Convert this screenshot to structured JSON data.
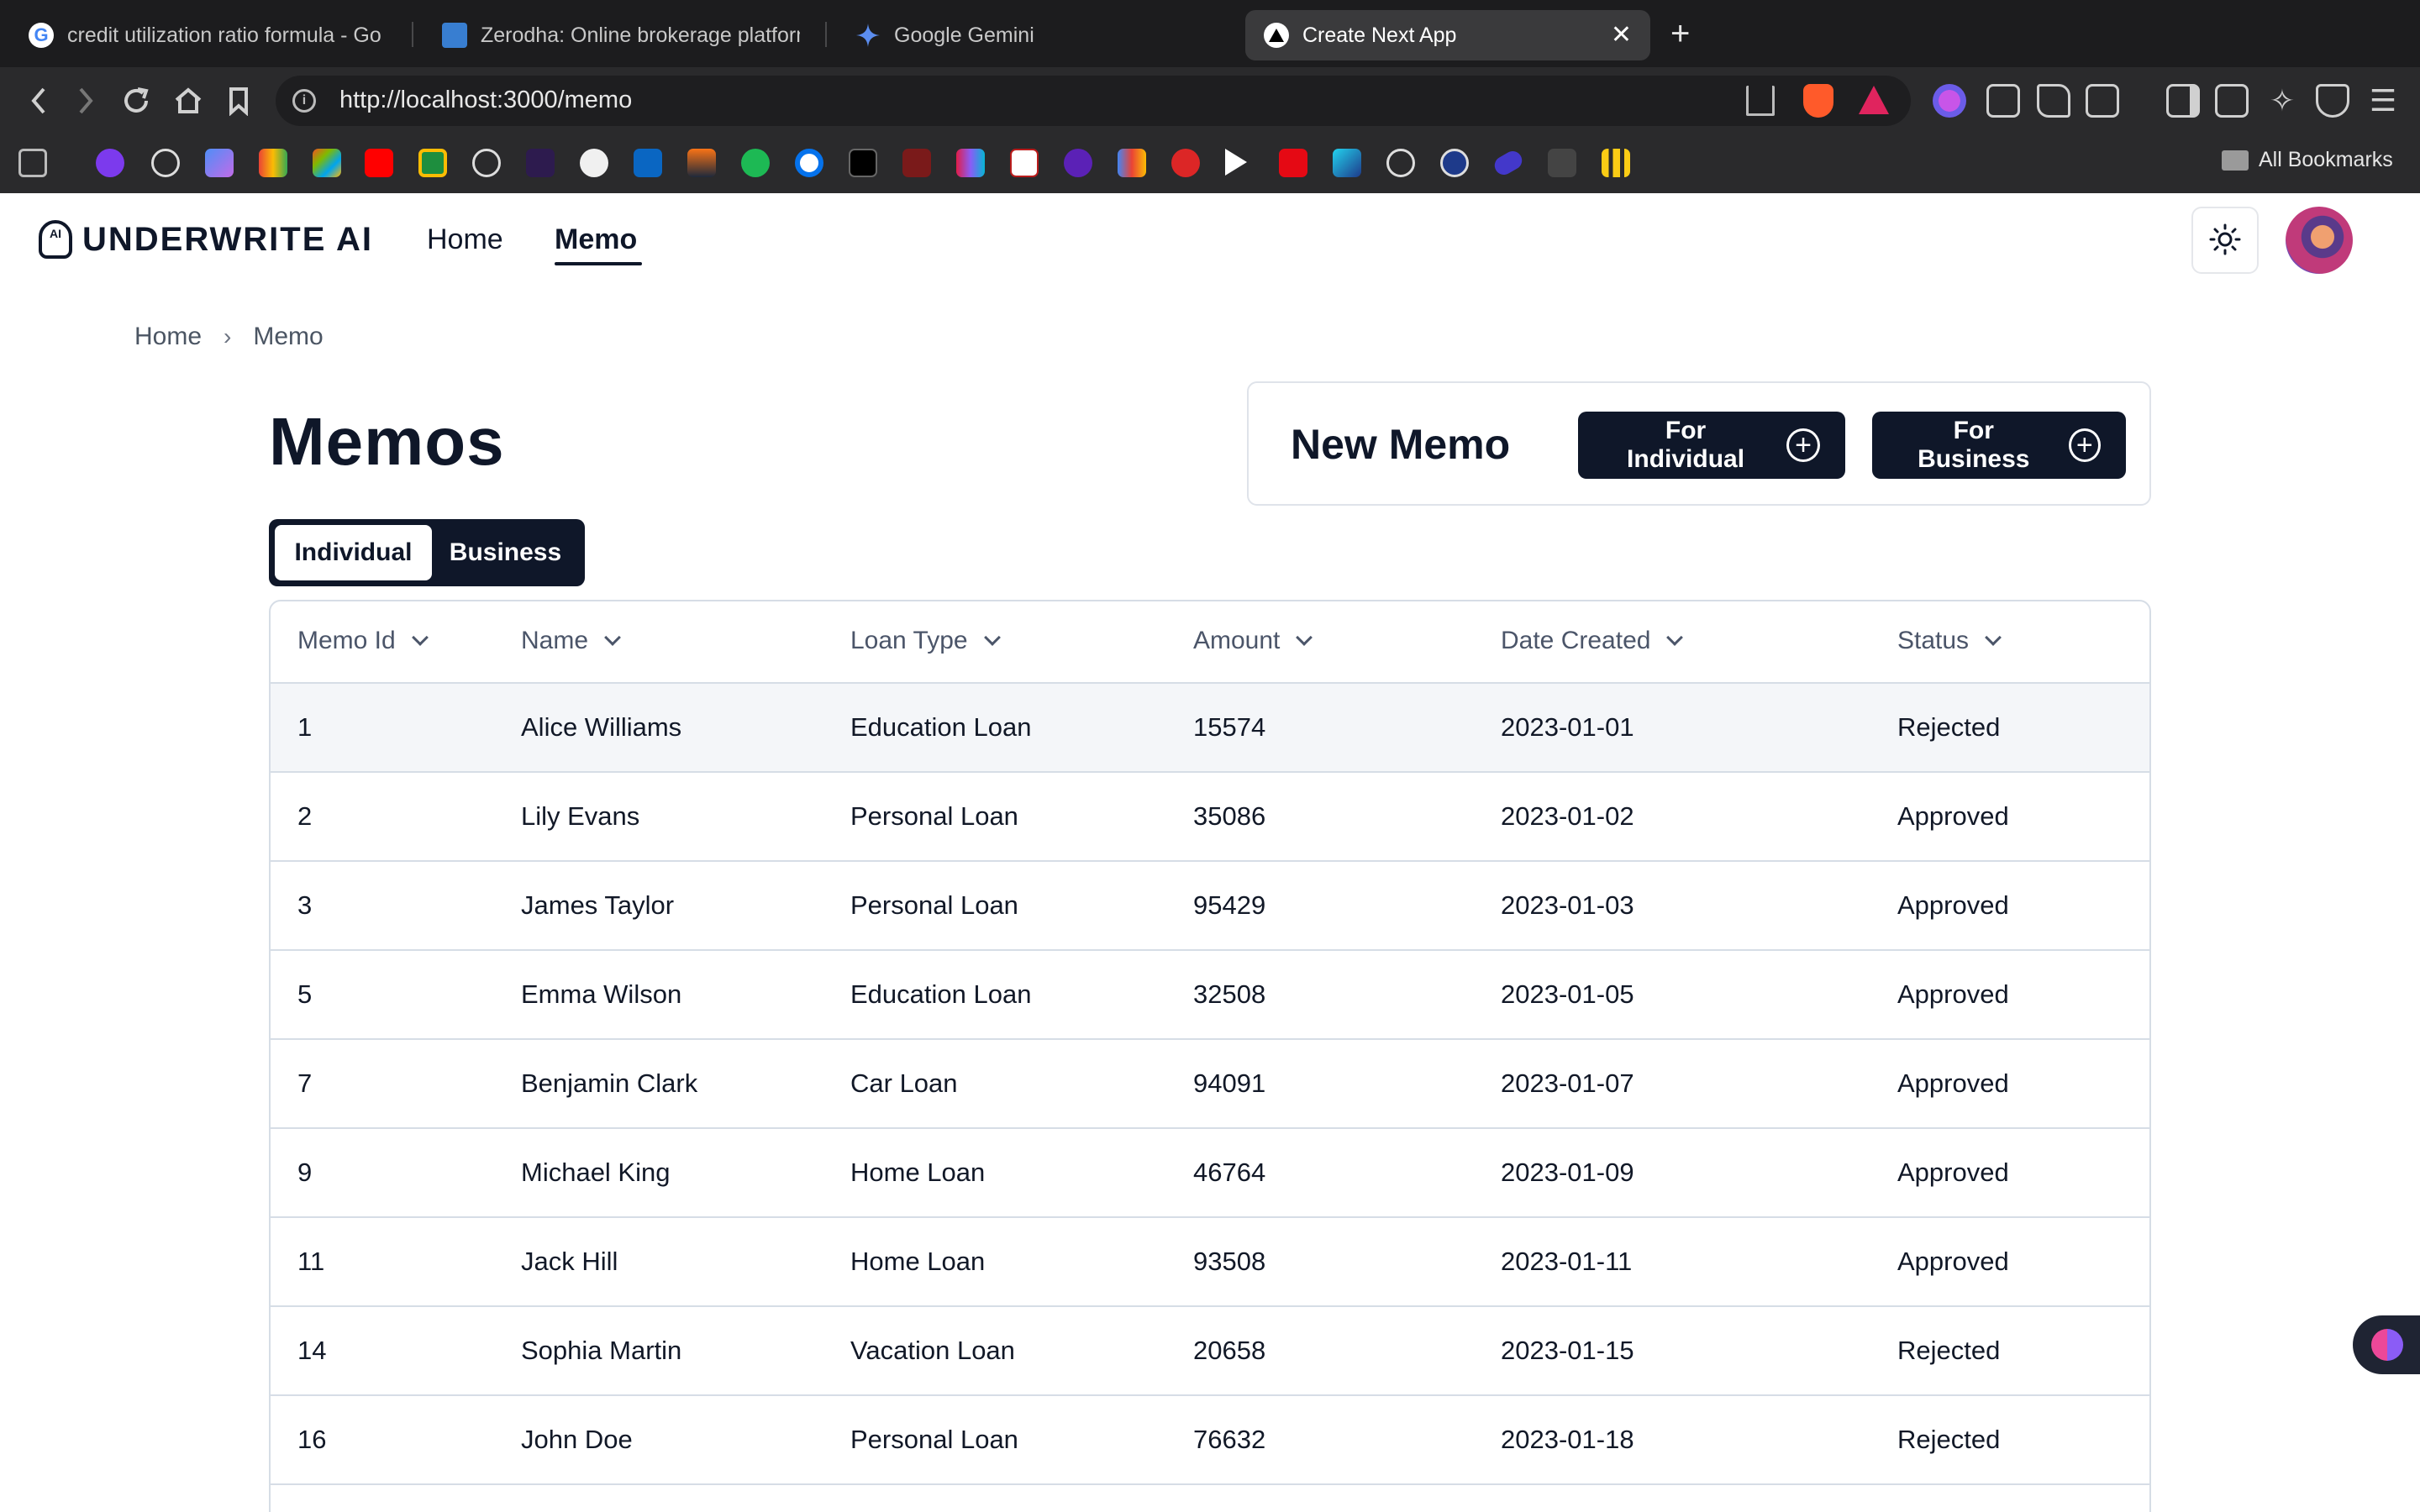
{
  "browser": {
    "tabs": [
      {
        "title": "credit utilization ratio formula - Go",
        "icon": "google-icon",
        "active": false
      },
      {
        "title": "Zerodha: Online brokerage platform",
        "icon": "zerodha-icon",
        "active": false
      },
      {
        "title": "Google Gemini",
        "icon": "gemini-icon",
        "active": false
      },
      {
        "title": "Create Next App",
        "icon": "nextjs-icon",
        "active": true
      }
    ],
    "url": "http://localhost:3000/memo",
    "all_bookmarks_label": "All Bookmarks",
    "bookmark_icons": [
      "apps-icon",
      "ublock-icon",
      "speed-icon",
      "gemini-icon",
      "gmail-icon",
      "office-icon",
      "youtube-icon",
      "classroom-icon",
      "chatgpt-icon",
      "hashnode-icon",
      "github-icon",
      "linkedin-icon",
      "mirror-icon",
      "spotify-icon",
      "onepassword-icon",
      "x-icon",
      "td-icon",
      "medium-icon",
      "dictionary-icon",
      "yahoo-icon",
      "drive-icon",
      "youtube-red-icon",
      "play-icon",
      "netflix-icon",
      "photo-icon",
      "openai-icon",
      "wordpress-icon",
      "link-icon",
      "avatar-icon",
      "bars-icon"
    ]
  },
  "app": {
    "logo_text": "UNDERWRITE AI",
    "logo_mark": "AI",
    "nav": [
      {
        "label": "Home"
      },
      {
        "label": "Memo"
      }
    ],
    "breadcrumb": [
      "Home",
      "Memo"
    ],
    "page_title": "Memos",
    "segment": {
      "individual": "Individual",
      "business": "Business"
    },
    "new_memo": {
      "title": "New Memo",
      "individual_button": "For Individual",
      "business_button": "For Business"
    },
    "table": {
      "columns": [
        "Memo Id",
        "Name",
        "Loan Type",
        "Amount",
        "Date Created",
        "Status"
      ],
      "rows": [
        [
          "1",
          "Alice Williams",
          "Education Loan",
          "15574",
          "2023-01-01",
          "Rejected"
        ],
        [
          "2",
          "Lily Evans",
          "Personal Loan",
          "35086",
          "2023-01-02",
          "Approved"
        ],
        [
          "3",
          "James Taylor",
          "Personal Loan",
          "95429",
          "2023-01-03",
          "Approved"
        ],
        [
          "5",
          "Emma Wilson",
          "Education Loan",
          "32508",
          "2023-01-05",
          "Approved"
        ],
        [
          "7",
          "Benjamin Clark",
          "Car Loan",
          "94091",
          "2023-01-07",
          "Approved"
        ],
        [
          "9",
          "Michael King",
          "Home Loan",
          "46764",
          "2023-01-09",
          "Approved"
        ],
        [
          "11",
          "Jack Hill",
          "Home Loan",
          "93508",
          "2023-01-11",
          "Approved"
        ],
        [
          "14",
          "Sophia Martin",
          "Vacation Loan",
          "20658",
          "2023-01-15",
          "Rejected"
        ],
        [
          "16",
          "John Doe",
          "Personal Loan",
          "76632",
          "2023-01-18",
          "Rejected"
        ]
      ]
    }
  },
  "colors": {
    "primary": "#0f1729",
    "border": "#d6dde6",
    "row_highlight": "#f4f6f9",
    "chrome_dark": "#1c1c1e"
  }
}
